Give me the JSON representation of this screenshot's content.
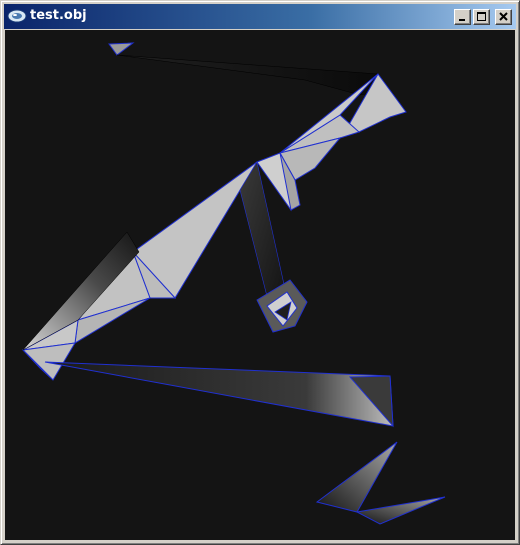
{
  "window": {
    "title": "test.obj",
    "icon": "window-app-icon",
    "controls": {
      "minimize": "minimize-icon",
      "maximize": "maximize-icon",
      "close": "close-icon"
    }
  },
  "viewport": {
    "background": "#141414",
    "face_color": "#c8c8c8",
    "edge_color": "#2030d0"
  }
}
